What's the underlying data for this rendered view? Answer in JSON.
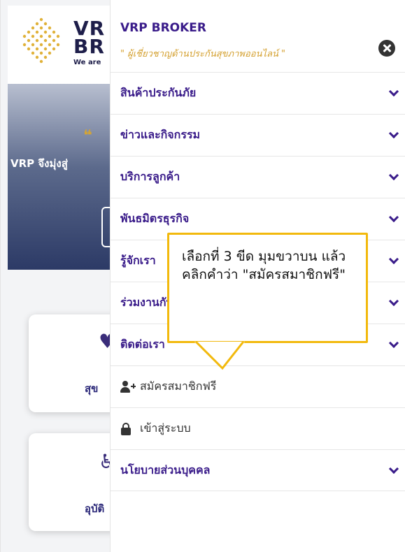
{
  "background": {
    "logo_text_line1": "VR",
    "logo_text_line2": "BR",
    "logo_tagline": "We are",
    "hero_quote_mark": "❝ ",
    "hero_text": "VRP จึงมุ่งสู่",
    "card1_label": "สุข",
    "card2_label": "อุบัติ"
  },
  "drawer": {
    "title": "VRP BROKER",
    "subtitle": "\" ผู้เชี่ยวชาญด้านประกันสุขภาพออนไลน์ \"",
    "close_icon": "close-icon",
    "menu": [
      {
        "label": "สินค้าประกันภัย",
        "has_chevron": true
      },
      {
        "label": "ข่าวและกิจกรรม",
        "has_chevron": true
      },
      {
        "label": "บริการลูกค้า",
        "has_chevron": true
      },
      {
        "label": "พันธมิตรธุรกิจ",
        "has_chevron": true
      },
      {
        "label": "รู้จักเรา",
        "has_chevron": true
      },
      {
        "label": "ร่วมงานกับเรา",
        "has_chevron": true
      },
      {
        "label": "ติดต่อเรา",
        "has_chevron": true
      },
      {
        "label": "สมัครสมาชิกฟรี",
        "icon": "user-plus-icon",
        "has_chevron": false
      },
      {
        "label": "เข้าสู่ระบบ",
        "icon": "lock-icon",
        "has_chevron": false
      },
      {
        "label": "นโยบายส่วนบุคคล",
        "has_chevron": true
      }
    ]
  },
  "callout": {
    "text": "เลือกที่ 3 ขีด มุมขวาบน แล้วคลิกคำว่า \"สมัครสมาชิกฟรี\""
  },
  "colors": {
    "brand_purple": "#3a1c8a",
    "accent_gold": "#d4a02f",
    "callout_border": "#f2b90d"
  }
}
